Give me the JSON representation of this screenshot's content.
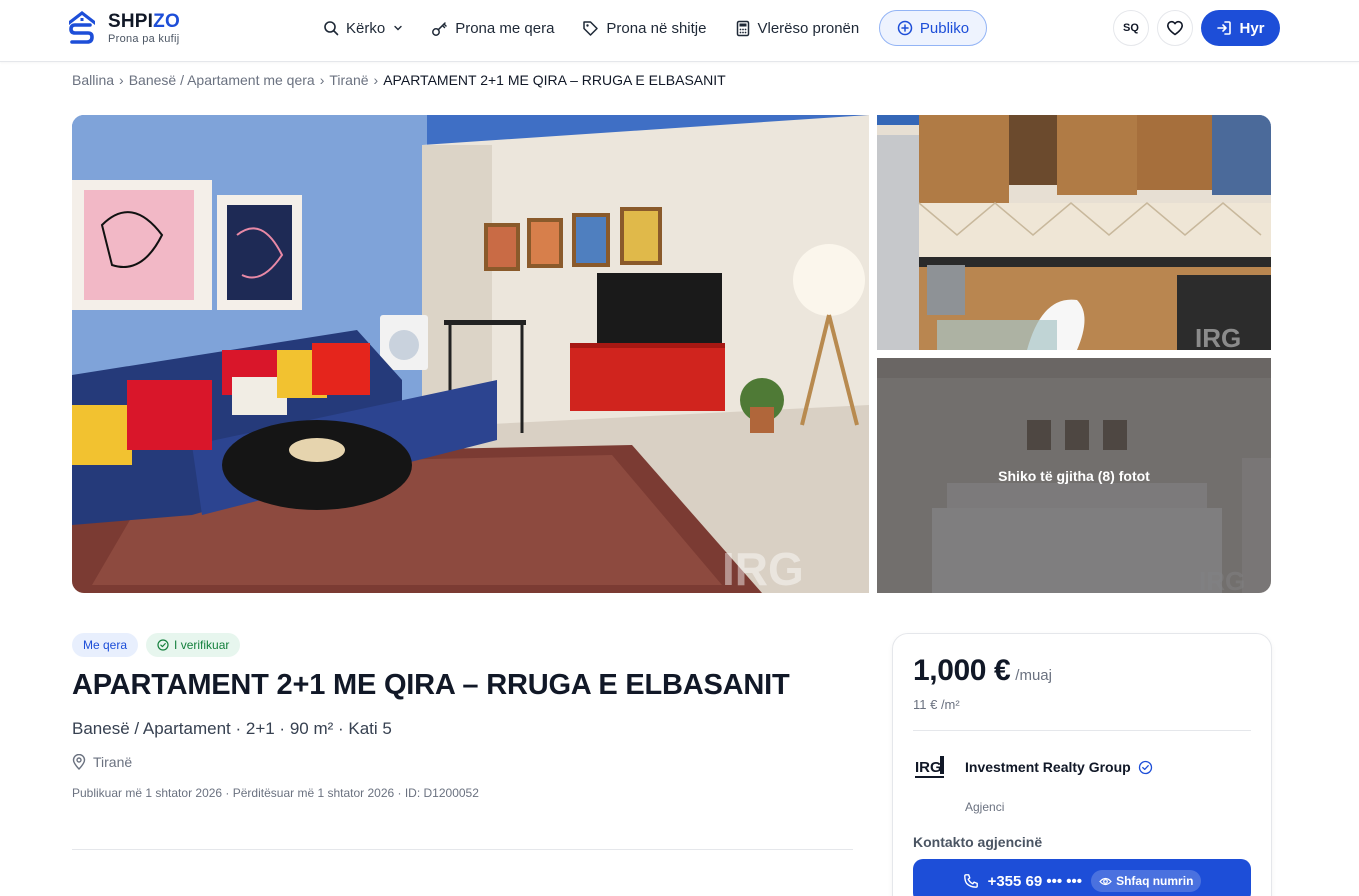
{
  "header": {
    "logo_prefix": "SHPI",
    "logo_suffix": "ZO",
    "logo_tagline": "Prona pa kufij",
    "nav": {
      "search": "Kërko",
      "rent": "Prona me qera",
      "sale": "Prona në shitje",
      "valuate": "Vlerëso pronën"
    },
    "publish": "Publiko",
    "language": "SQ",
    "login": "Hyr"
  },
  "breadcrumb": {
    "home": "Ballina",
    "category": "Banesë / Apartament me qera",
    "city": "Tiranë",
    "current": "APARTAMENT 2+1 ME QIRA – RRUGA E ELBASANIT",
    "separator": "›"
  },
  "gallery": {
    "view_all": "Shiko të gjitha (8) fotot"
  },
  "listing": {
    "badge_type": "Me qera",
    "badge_verified": "I verifikuar",
    "title": "APARTAMENT 2+1 ME QIRA – RRUGA E ELBASANIT",
    "summary": "Banesë / Apartament · 2+1 · 90 m² · Kati 5",
    "location": "Tiranë",
    "meta": "Publikuar më 1 shtator 2026 · Përditësuar më 1 shtator 2026 · ID: D1200052"
  },
  "price_card": {
    "price": "1,000 €",
    "price_unit": "/muaj",
    "price_per_sqm": "11 € /m²",
    "agency_name": "Investment Realty Group",
    "agency_logo_text": "IRG",
    "agency_type": "Agjenci",
    "contact_label": "Kontakto agjencinë",
    "phone_masked": "+355 69 ••• •••",
    "reveal_label": "Shfaq numrin"
  },
  "colors": {
    "primary": "#1d4ed8",
    "verified": "#15803d"
  },
  "icons": [
    "search-icon",
    "key-icon",
    "tag-icon",
    "calculator-icon",
    "plus-circle-icon",
    "heart-icon",
    "login-icon",
    "pin-icon",
    "check-circle-icon",
    "phone-icon",
    "eye-icon",
    "verified-icon"
  ]
}
